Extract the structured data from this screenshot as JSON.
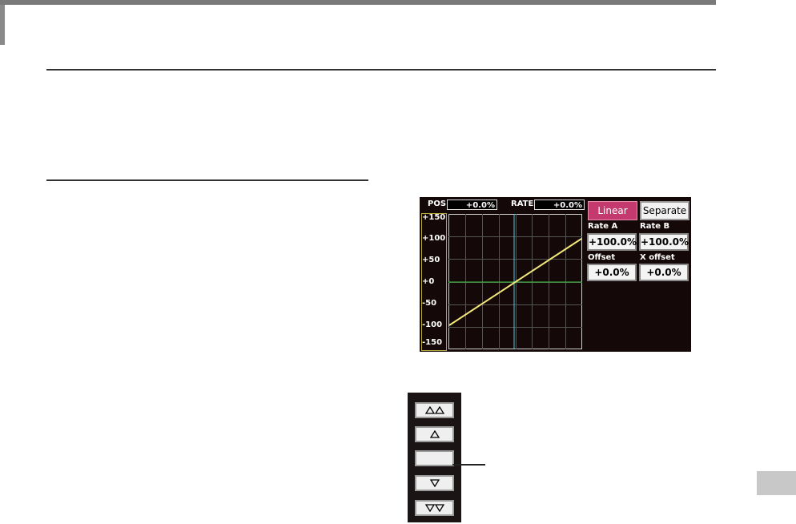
{
  "screen": {
    "pos_label": "POS",
    "pos_value": "+0.0%",
    "rate_label": "RATE",
    "rate_value": "+0.0%",
    "y_ticks": [
      "+150",
      "+100",
      "+50",
      "+0",
      "-50",
      "-100",
      "-150"
    ],
    "curve_color": "#f0e87a",
    "axis_h_color": "#3cc83c",
    "axis_v_color": "#4fc9e0",
    "linear_button": "Linear",
    "separate_button": "Separate",
    "rate_a_label": "Rate A",
    "rate_a_value": "+100.0%",
    "rate_b_label": "Rate B",
    "rate_b_value": "+100.0%",
    "offset_label": "Offset",
    "offset_value": "+0.0%",
    "x_offset_label": "X offset",
    "x_offset_value": "+0.0%"
  },
  "panel": {
    "buttons": [
      "up-fast",
      "up",
      "blank",
      "down",
      "down-fast"
    ]
  },
  "colors": {
    "accent": "#c43a6e",
    "screen_bg": "#150808"
  }
}
